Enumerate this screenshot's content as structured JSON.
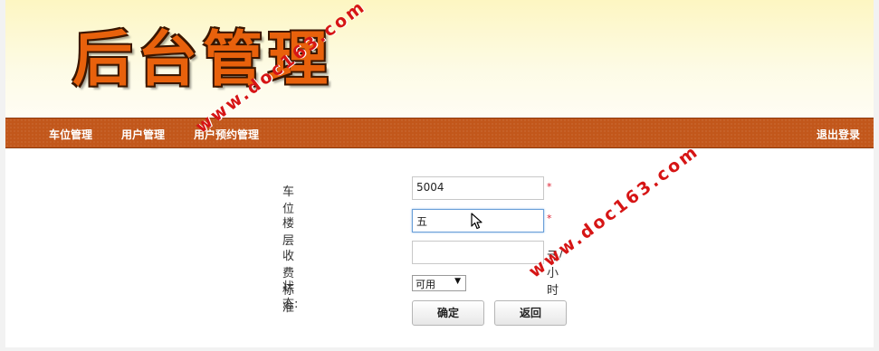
{
  "header": {
    "logo_text": "后台管理"
  },
  "nav": {
    "items": [
      {
        "label": "车位管理"
      },
      {
        "label": "用户管理"
      },
      {
        "label": "用户预约管理"
      }
    ],
    "logout": "退出登录"
  },
  "form": {
    "parking_label": "车位",
    "parking_value": "5004",
    "floor_label": "楼层",
    "floor_value": "五",
    "fee_label": "收费标准",
    "fee_value": "",
    "fee_unit": "元/小时",
    "status_label": "状态:",
    "status_value": "可用",
    "required_mark": "*",
    "confirm_label": "确定",
    "back_label": "返回"
  },
  "watermark": {
    "text": "www.doc163.com"
  },
  "colors": {
    "navbar": "#c2571b",
    "logo": "#e8610c",
    "watermark": "#d61515"
  }
}
